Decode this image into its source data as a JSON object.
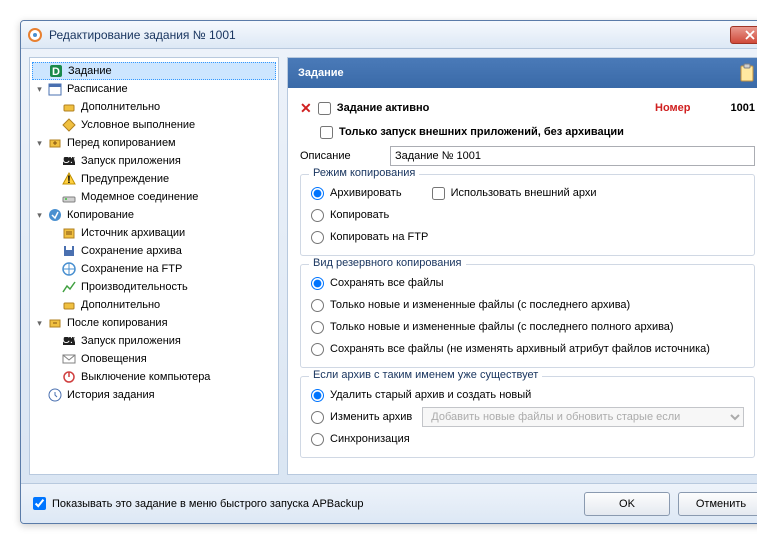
{
  "window": {
    "title": "Редактирование задания № 1001"
  },
  "tree": {
    "items": [
      {
        "label": "Задание",
        "indent": 0,
        "toggle": "",
        "icon": "task",
        "selected": true
      },
      {
        "label": "Расписание",
        "indent": 0,
        "toggle": "▾",
        "icon": "schedule"
      },
      {
        "label": "Дополнительно",
        "indent": 1,
        "toggle": "",
        "icon": "addon"
      },
      {
        "label": "Условное выполнение",
        "indent": 1,
        "toggle": "",
        "icon": "cond"
      },
      {
        "label": "Перед копированием",
        "indent": 0,
        "toggle": "▾",
        "icon": "before"
      },
      {
        "label": "Запуск приложения",
        "indent": 1,
        "toggle": "",
        "icon": "app"
      },
      {
        "label": "Предупреждение",
        "indent": 1,
        "toggle": "",
        "icon": "warn"
      },
      {
        "label": "Модемное соединение",
        "indent": 1,
        "toggle": "",
        "icon": "modem"
      },
      {
        "label": "Копирование",
        "indent": 0,
        "toggle": "▾",
        "icon": "copy"
      },
      {
        "label": "Источник архивации",
        "indent": 1,
        "toggle": "",
        "icon": "source"
      },
      {
        "label": "Сохранение архива",
        "indent": 1,
        "toggle": "",
        "icon": "save"
      },
      {
        "label": "Сохранение на FTP",
        "indent": 1,
        "toggle": "",
        "icon": "ftp"
      },
      {
        "label": "Производительность",
        "indent": 1,
        "toggle": "",
        "icon": "perf"
      },
      {
        "label": "Дополнительно",
        "indent": 1,
        "toggle": "",
        "icon": "addon"
      },
      {
        "label": "После копирования",
        "indent": 0,
        "toggle": "▾",
        "icon": "after"
      },
      {
        "label": "Запуск приложения",
        "indent": 1,
        "toggle": "",
        "icon": "app"
      },
      {
        "label": "Оповещения",
        "indent": 1,
        "toggle": "",
        "icon": "notify"
      },
      {
        "label": "Выключение компьютера",
        "indent": 1,
        "toggle": "",
        "icon": "power"
      },
      {
        "label": "История задания",
        "indent": 0,
        "toggle": "",
        "icon": "history"
      }
    ]
  },
  "content": {
    "header": "Задание",
    "active_label": "Задание активно",
    "number_label": "Номер",
    "number_value": "1001",
    "only_external_label": "Только запуск внешних приложений, без архивации",
    "desc_label": "Описание",
    "desc_value": "Задание № 1001",
    "group1": {
      "title": "Режим копирования",
      "opt1": "Архивировать",
      "opt1_cb": "Использовать внешний архи",
      "opt2": "Копировать",
      "opt3": "Копировать на FTP"
    },
    "group2": {
      "title": "Вид резервного копирования",
      "opt1": "Сохранять все файлы",
      "opt2": "Только новые и измененные файлы (с последнего архива)",
      "opt3": "Только новые и измененные файлы (с последнего полного архива)",
      "opt4": "Сохранять все файлы (не изменять архивный атрибут файлов источника)"
    },
    "group3": {
      "title": "Если архив с таким именем уже существует",
      "opt1": "Удалить старый архив и создать новый",
      "opt2": "Изменить архив",
      "opt2_select": "Добавить новые файлы и обновить старые если",
      "opt3": "Синхронизация"
    }
  },
  "footer": {
    "show_label": "Показывать это задание в меню быстрого запуска APBackup",
    "ok": "OK",
    "cancel": "Отменить"
  }
}
